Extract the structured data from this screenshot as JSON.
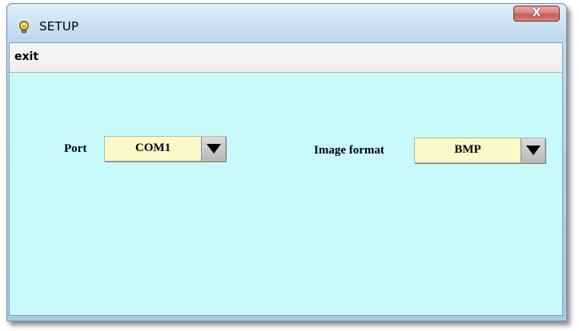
{
  "window": {
    "title": "SETUP",
    "title_icon": "lightbulb-icon",
    "close_icon": "close-icon",
    "close_glyph": "X"
  },
  "menu": {
    "exit_label": "exit"
  },
  "settings": {
    "port": {
      "label": "Port",
      "value": "COM1",
      "arrow_icon": "dropdown-arrow-icon"
    },
    "image_format": {
      "label": "Image format",
      "value": "BMP",
      "arrow_icon": "dropdown-arrow-icon"
    }
  },
  "colors": {
    "client_background": "#c8fafa",
    "combo_background": "#fdf8c8",
    "close_button": "#c45a4f"
  }
}
